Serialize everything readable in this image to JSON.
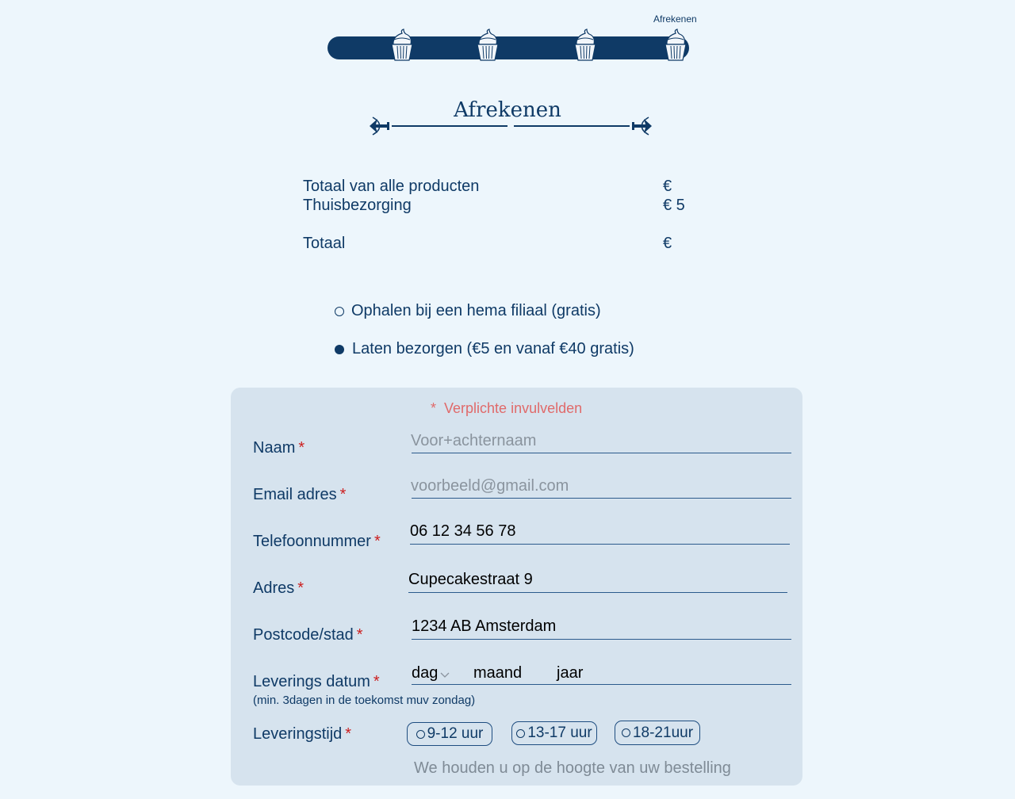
{
  "progress": {
    "current_step_label": "Afrekenen",
    "steps": [
      "cupcake-step-1",
      "cupcake-step-2",
      "cupcake-step-3",
      "cupcake-step-4"
    ]
  },
  "page": {
    "title": "Afrekenen"
  },
  "totals": {
    "products_label": "Totaal van alle producten",
    "products_value": "€",
    "delivery_label": "Thuisbezorging",
    "delivery_value": "€ 5",
    "total_label": "Totaal",
    "total_value": "€"
  },
  "delivery_options": {
    "pickup_label": "Ophalen bij een hema filiaal (gratis)",
    "pickup_selected": false,
    "deliver_label": "Laten bezorgen (€5 en vanaf €40 gratis)",
    "deliver_selected": true
  },
  "form": {
    "required_note": "Verplichte invulvelden",
    "required_star": "*",
    "name": {
      "label": "Naam",
      "placeholder": "Voor+achternaam",
      "value": ""
    },
    "email": {
      "label": "Email adres",
      "placeholder": "voorbeeld@gmail.com",
      "value": ""
    },
    "phone": {
      "label": "Telefoonnummer",
      "value": "06 12 34 56 78"
    },
    "address": {
      "label": "Adres",
      "value": "Cupecakestraat 9"
    },
    "postcode": {
      "label": "Postcode/stad",
      "value": "1234 AB Amsterdam"
    },
    "delivery_date": {
      "label": "Leverings datum",
      "hint": "(min. 3dagen in de toekomst muv zondag)",
      "day": "dag",
      "month": "maand",
      "year": "jaar"
    },
    "delivery_time": {
      "label": "Leveringstijd",
      "options": [
        "9-12 uur",
        "13-17 uur",
        "18-21uur"
      ]
    },
    "footer": "We houden u op de hoogte van uw bestelling"
  },
  "colors": {
    "navy": "#0f3a66",
    "background": "#edf6fc",
    "panel": "#d6e3ee",
    "required_red": "#cc1f1f",
    "note_red": "#e06a6a"
  }
}
